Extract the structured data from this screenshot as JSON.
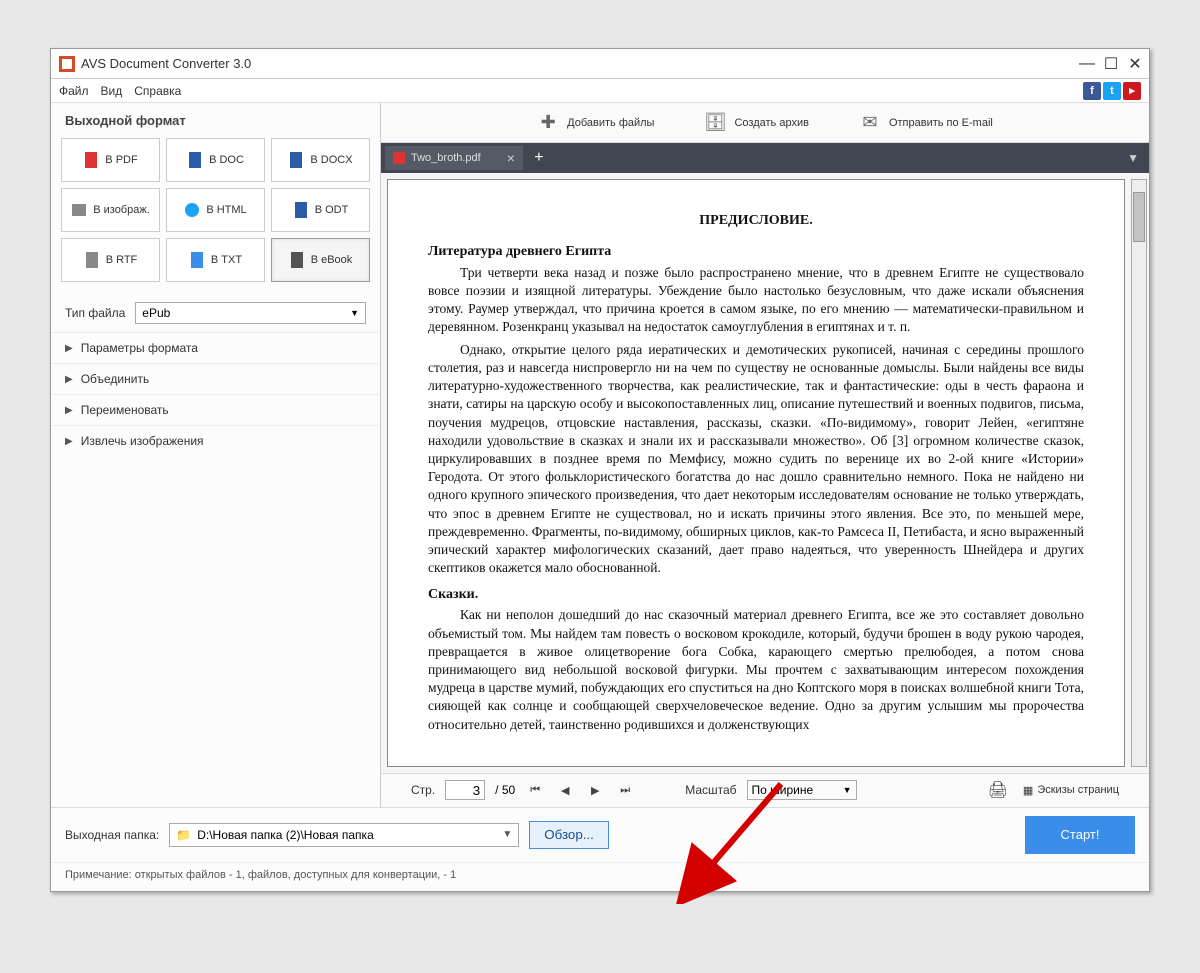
{
  "window": {
    "title": "AVS Document Converter 3.0"
  },
  "menu": {
    "file": "Файл",
    "view": "Вид",
    "help": "Справка"
  },
  "sidebar": {
    "title": "Выходной формат",
    "formats": [
      {
        "label": "В PDF"
      },
      {
        "label": "В DOC"
      },
      {
        "label": "В DOCX"
      },
      {
        "label": "В изображ."
      },
      {
        "label": "В HTML"
      },
      {
        "label": "В ODT"
      },
      {
        "label": "В RTF"
      },
      {
        "label": "В TXT"
      },
      {
        "label": "В eBook"
      }
    ],
    "file_type_label": "Тип файла",
    "file_type_value": "ePub",
    "sections": [
      {
        "label": "Параметры формата"
      },
      {
        "label": "Объединить"
      },
      {
        "label": "Переименовать"
      },
      {
        "label": "Извлечь изображения"
      }
    ]
  },
  "toolbar": {
    "add_files": "Добавить файлы",
    "create_archive": "Создать архив",
    "send_email": "Отправить по E-mail"
  },
  "tabs": {
    "active": "Two_broth.pdf"
  },
  "document": {
    "title": "ПРЕДИСЛОВИЕ.",
    "h1": "Литература древнего Египта",
    "p1": "Три четверти века назад и позже было распространено мнение, что в древнем Египте не существовало вовсе поэзии и изящной литературы. Убеждение было настолько безусловным, что даже искали объяснения этому. Раумер утверждал, что причина кроется в самом языке, по его мнению — математически-правильном и деревянном. Розенкранц указывал на недостаток самоуглубления в египтянах и т. п.",
    "p2": "Однако, открытие целого ряда иератических и демотических рукописей, начиная с середины прошлого столетия, раз и навсегда ниспровергло ни на чем по существу не основанные домыслы. Были найдены все виды литературно-художественного творчества, как реалистические, так и фантастические: оды в честь фараона и знати, сатиры на царскую особу и высокопоставленных лиц, описание путешествий и военных подвигов, письма, поучения мудрецов, отцовские наставления, рассказы, сказки. «По-видимому», говорит Лейен, «египтяне находили удовольствие в сказках и знали их и рассказывали множество». Об [3] огромном количестве сказок, циркулировавших в позднее время по Мемфису, можно судить по веренице их во 2-ой книге «Истории» Геродота. От этого фольклористического богатства до нас дошло сравнительно немного. Пока не найдено ни одного крупного эпического произведения, что дает некоторым исследователям основание не только утверждать, что эпос в древнем Египте не существовал, но и искать причины этого явления. Все это, по меньшей мере, преждевременно. Фрагменты, по-видимому, обширных циклов, как-то Рамсеса II, Петибаста, и ясно выраженный эпический характер мифологических сказаний, дает право надеяться, что уверенность Шнейдера и других скептиков окажется мало обоснованной.",
    "h2": "Сказки.",
    "p3": "Как ни неполон дошедший до нас сказочный материал древнего Египта, все же это составляет довольно объемистый том. Мы найдем там повесть о восковом крокодиле, который, будучи брошен в воду рукою чародея, превращается в живое олицетворение бога Собка, карающего смертью прелюбодея, а потом снова принимающего вид небольшой восковой фигурки. Мы прочтем с захватывающим интересом похождения мудреца в царстве мумий, побуждающих его спуститься на дно Коптского моря в поисках волшебной книги Тота, сияющей как солнце и сообщающей сверхчеловеческое ведение. Одно за другим услышим мы пророчества относительно детей, таинственно родившихся и долженствующих"
  },
  "pagenav": {
    "page_label": "Стр.",
    "current": "3",
    "total": "/ 50",
    "zoom_label": "Масштаб",
    "zoom_value": "По ширине",
    "thumbnails": "Эскизы страниц"
  },
  "output": {
    "label": "Выходная папка:",
    "path": "D:\\Новая папка (2)\\Новая папка",
    "browse": "Обзор...",
    "start": "Старт!"
  },
  "note": "Примечание: открытых файлов - 1, файлов, доступных для конвертации, - 1"
}
